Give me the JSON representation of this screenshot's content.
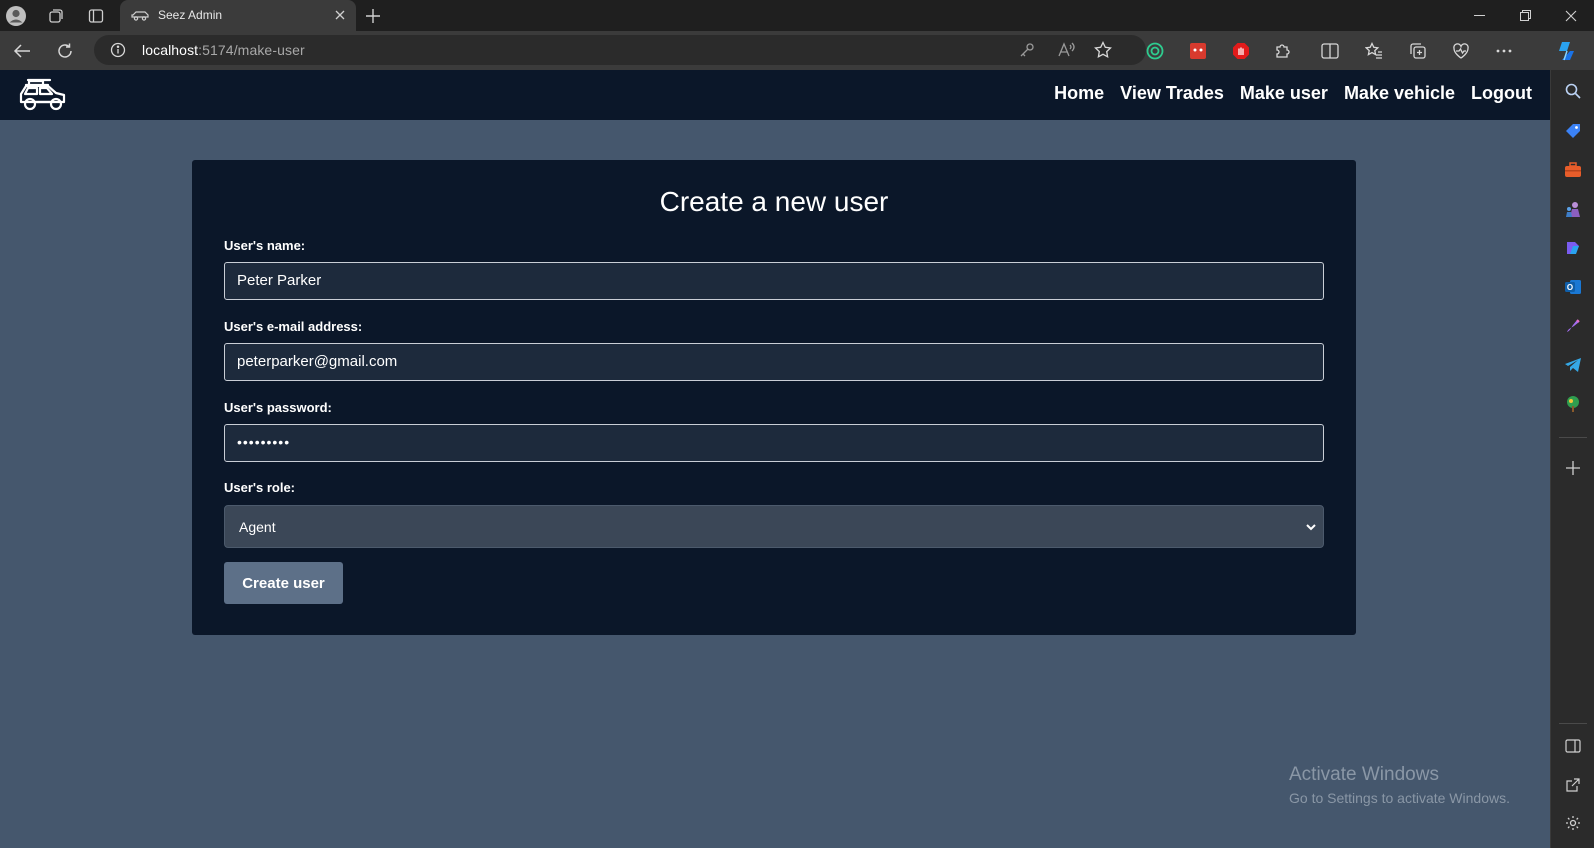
{
  "browser": {
    "tab_title": "Seez Admin",
    "url_host": "localhost",
    "url_path": ":5174/make-user"
  },
  "navbar": {
    "logo_icon": "car-icon",
    "links": [
      "Home",
      "View Trades",
      "Make user",
      "Make vehicle",
      "Logout"
    ]
  },
  "form": {
    "title": "Create a new user",
    "name_label": "User's name:",
    "name_value": "Peter Parker",
    "email_label": "User's e-mail address:",
    "email_value": "peterparker@gmail.com",
    "password_label": "User's password:",
    "password_value": "•••••••••",
    "role_label": "User's role:",
    "role_value": "Agent",
    "submit_label": "Create user"
  },
  "watermark": {
    "line1": "Activate Windows",
    "line2": "Go to Settings to activate Windows."
  },
  "colors": {
    "navbar_bg": "#0b1729",
    "page_bg": "#45576d",
    "button_bg": "#5d7088"
  }
}
